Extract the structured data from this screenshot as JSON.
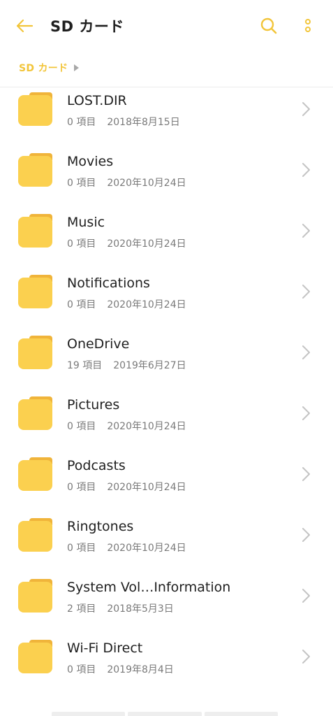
{
  "header": {
    "title": "SD カード",
    "back_icon": "arrow-left-icon",
    "search_icon": "search-icon",
    "more_icon": "more-vertical-icon",
    "accent_color": "#F2C53A"
  },
  "breadcrumb": {
    "items": [
      {
        "label": "SD カード"
      }
    ]
  },
  "folders": [
    {
      "name": "LOST.DIR",
      "count": "0 項目",
      "date": "2018年8月15日"
    },
    {
      "name": "Movies",
      "count": "0 項目",
      "date": "2020年10月24日"
    },
    {
      "name": "Music",
      "count": "0 項目",
      "date": "2020年10月24日"
    },
    {
      "name": "Notifications",
      "count": "0 項目",
      "date": "2020年10月24日"
    },
    {
      "name": "OneDrive",
      "count": "19 項目",
      "date": "2019年6月27日"
    },
    {
      "name": "Pictures",
      "count": "0 項目",
      "date": "2020年10月24日"
    },
    {
      "name": "Podcasts",
      "count": "0 項目",
      "date": "2020年10月24日"
    },
    {
      "name": "Ringtones",
      "count": "0 項目",
      "date": "2020年10月24日"
    },
    {
      "name": "System Vol…Information",
      "count": "2 項目",
      "date": "2018年5月3日"
    },
    {
      "name": "Wi-Fi Direct",
      "count": "0 項目",
      "date": "2019年8月4日"
    }
  ],
  "colors": {
    "folder_body": "#FBD04F",
    "folder_tab": "#F0B43A",
    "chevron": "#C4C4C4"
  }
}
